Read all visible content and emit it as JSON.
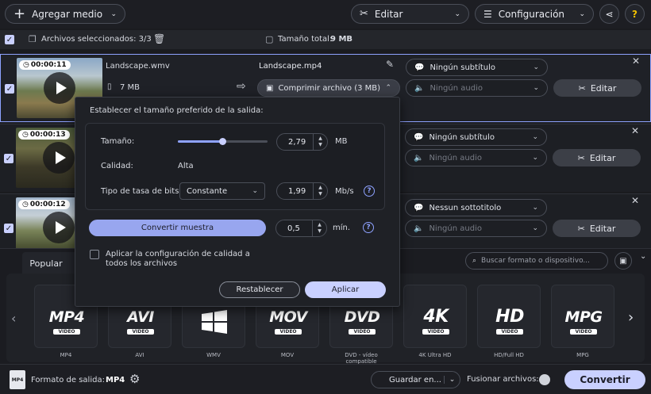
{
  "topbar": {
    "add_media": "Agregar medio",
    "edit": "Editar",
    "settings": "Configuración",
    "help": "?"
  },
  "toolbar": {
    "selected_files": "Archivos seleccionados: 3/3",
    "total_size_label": "Tamaño total:",
    "total_size_value": "9 MB"
  },
  "files": [
    {
      "duration": "00:00:11",
      "source_name": "Landscape.wmv",
      "source_size": "7 MB",
      "output_name": "Landscape.mp4",
      "compress_label": "Comprimir archivo (3 MB)",
      "subtitle": "Ningún subtítulo",
      "audio": "Ningún audio",
      "edit": "Editar"
    },
    {
      "duration": "00:00:13",
      "subtitle": "Ningún subtítulo",
      "audio": "Ningún audio",
      "edit": "Editar"
    },
    {
      "duration": "00:00:12",
      "subtitle": "Nessun sottotitolo",
      "audio": "Ningún audio",
      "edit": "Editar"
    }
  ],
  "popup": {
    "title": "Establecer el tamaño preferido de la salida:",
    "size_label": "Tamaño:",
    "size_value": "2,79",
    "size_unit": "MB",
    "size_slider_level": 0.5,
    "quality_label": "Calidad:",
    "quality_value": "Alta",
    "bitrate_type_label": "Tipo de tasa de bits",
    "bitrate_type_value": "Constante",
    "bitrate_value": "1,99",
    "bitrate_unit": "Mb/s",
    "convert_sample": "Convertir muestra",
    "sample_value": "0,5",
    "sample_unit": "mín.",
    "apply_all": "Aplicar la configuración de calidad a todos los archivos",
    "reset": "Restablecer",
    "apply": "Aplicar"
  },
  "formats_panel": {
    "tab_popular": "Popular",
    "search_placeholder": "Buscar formato o dispositivo...",
    "formats": [
      {
        "badge": "MP4",
        "label": "MP4"
      },
      {
        "badge": "AVI",
        "label": "AVI"
      },
      {
        "badge": "WMV",
        "label": "WMV"
      },
      {
        "badge": "MOV",
        "label": "MOV"
      },
      {
        "badge": "DVD",
        "label": "DVD - vídeo compatible"
      },
      {
        "badge": "4K",
        "label": "4K Ultra HD"
      },
      {
        "badge": "HD",
        "label": "HD/Full HD"
      },
      {
        "badge": "MPG",
        "label": "MPG"
      }
    ],
    "video_tag": "VIDEO"
  },
  "bottombar": {
    "output_format_label": "Formato de salida:",
    "output_format_value": "MP4",
    "save_to": "Guardar en...",
    "merge_files": "Fusionar archivos:",
    "convert": "Convertir"
  },
  "colors": {
    "accent": "#8ea2ff",
    "convert_button": "#c9d0ff",
    "background": "#1a1b1f"
  }
}
